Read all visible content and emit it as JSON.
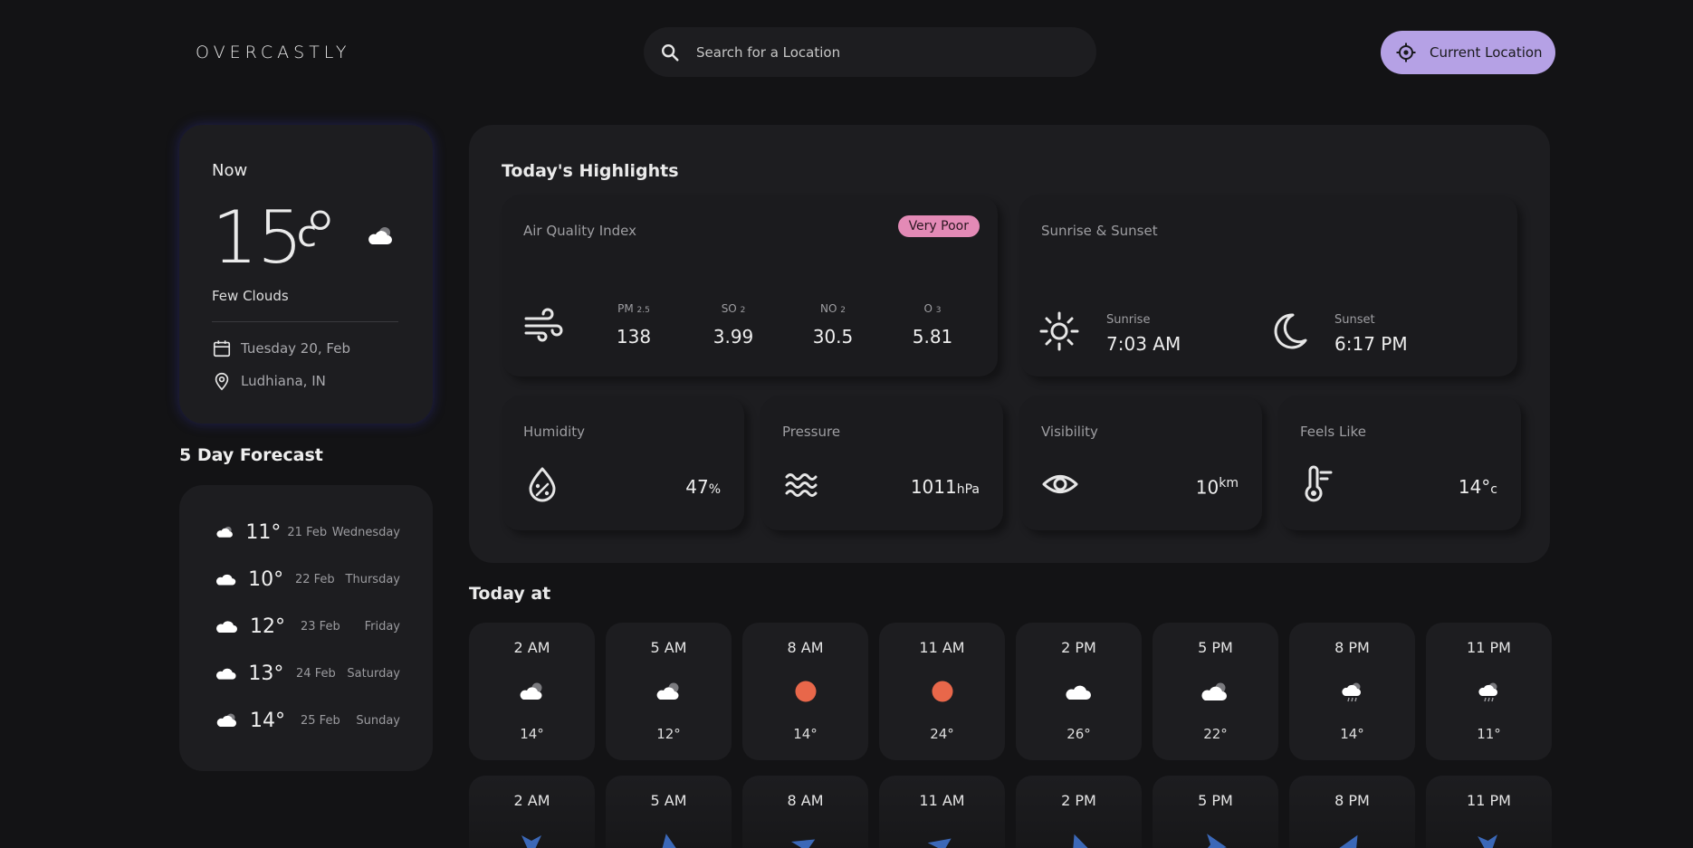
{
  "app": {
    "logo": "OVERCASTLY"
  },
  "search": {
    "placeholder": "Search for a Location"
  },
  "current_location_label": "Current Location",
  "now": {
    "label": "Now",
    "temp": "15°",
    "unit": "c",
    "description": "Few Clouds",
    "date": "Tuesday 20, Feb",
    "location": "Ludhiana, IN"
  },
  "forecast": {
    "title": "5 Day Forecast",
    "days": [
      {
        "temp": "11°",
        "date": "21 Feb",
        "day": "Wednesday"
      },
      {
        "temp": "10°",
        "date": "22 Feb",
        "day": "Thursday"
      },
      {
        "temp": "12°",
        "date": "23 Feb",
        "day": "Friday"
      },
      {
        "temp": "13°",
        "date": "24 Feb",
        "day": "Saturday"
      },
      {
        "temp": "14°",
        "date": "25 Feb",
        "day": "Sunday"
      }
    ]
  },
  "highlights": {
    "title": "Today's Highlights",
    "aqi": {
      "label": "Air Quality Index",
      "badge": "Very Poor",
      "badge_color": "#e38ab6",
      "items": [
        {
          "label": "PM",
          "sub": "2.5",
          "value": "138"
        },
        {
          "label": "SO",
          "sub": "2",
          "value": "3.99"
        },
        {
          "label": "NO",
          "sub": "2",
          "value": "30.5"
        },
        {
          "label": "O",
          "sub": "3",
          "value": "5.81"
        }
      ]
    },
    "sun": {
      "label": "Sunrise & Sunset",
      "sunrise_label": "Sunrise",
      "sunrise": "7:03 AM",
      "sunset_label": "Sunset",
      "sunset": "6:17 PM"
    },
    "humidity": {
      "label": "Humidity",
      "value": "47",
      "unit": "%"
    },
    "pressure": {
      "label": "Pressure",
      "value": "1011",
      "unit": "hPa"
    },
    "visibility": {
      "label": "Visibility",
      "value": "10",
      "unit": "km"
    },
    "feels_like": {
      "label": "Feels Like",
      "value": "14°",
      "unit": "c"
    }
  },
  "today": {
    "title": "Today at",
    "hours": [
      {
        "time": "2 AM",
        "temp": "14°",
        "icon": "cloud-sun-icon"
      },
      {
        "time": "5 AM",
        "temp": "12°",
        "icon": "cloud-sun-icon"
      },
      {
        "time": "8 AM",
        "temp": "14°",
        "icon": "sun-icon"
      },
      {
        "time": "11 AM",
        "temp": "24°",
        "icon": "sun-icon"
      },
      {
        "time": "2 PM",
        "temp": "26°",
        "icon": "cloud-icon"
      },
      {
        "time": "5 PM",
        "temp": "22°",
        "icon": "cloud-sun-icon"
      },
      {
        "time": "8 PM",
        "temp": "14°",
        "icon": "cloud-rain-icon"
      },
      {
        "time": "11 PM",
        "temp": "11°",
        "icon": "cloud-rain-icon"
      }
    ],
    "wind_times": [
      "2 AM",
      "5 AM",
      "8 AM",
      "11 AM",
      "2 PM",
      "5 PM",
      "8 PM",
      "11 PM"
    ]
  },
  "colors": {
    "accent": "#b5a1e5",
    "background": "#131315",
    "card": "#1d1d20",
    "sun": "#e8674a",
    "wind_arrow": "#3b68b8"
  }
}
